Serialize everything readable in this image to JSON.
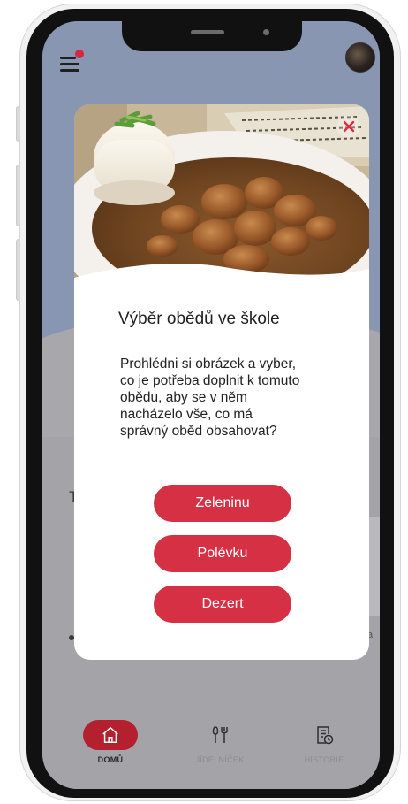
{
  "icons": {
    "menu": "hamburger-menu-icon",
    "notification": "notification-dot-icon",
    "avatar": "user-avatar",
    "close": "close-icon",
    "home": "home-icon",
    "menu_fork": "fork-knife-icon",
    "history": "history-document-icon"
  },
  "colors": {
    "accent": "#d63045",
    "nav_active": "#b5202f",
    "overlay_top": "#8896b1",
    "overlay_bottom": "#a4a4a8"
  },
  "background": {
    "section_letter": "T",
    "fragment_text": "a"
  },
  "modal": {
    "title": "Výběr obědů ve škole",
    "text": "Prohlédni si obrázek a vyber, co je potřeba doplnit k tomuto obědu, aby se v něm nacházelo vše, co má správný oběd obsahovat?",
    "image_alt": "rice-with-meat-goulash-plate",
    "options": [
      "Zeleninu",
      "Polévku",
      "Dezert"
    ]
  },
  "nav": {
    "items": [
      {
        "label": "DOMŮ",
        "icon": "home-icon",
        "active": true
      },
      {
        "label": "JÍDELNÍČEK",
        "icon": "fork-knife-icon",
        "active": false
      },
      {
        "label": "HISTORIE",
        "icon": "history-document-icon",
        "active": false
      }
    ]
  }
}
